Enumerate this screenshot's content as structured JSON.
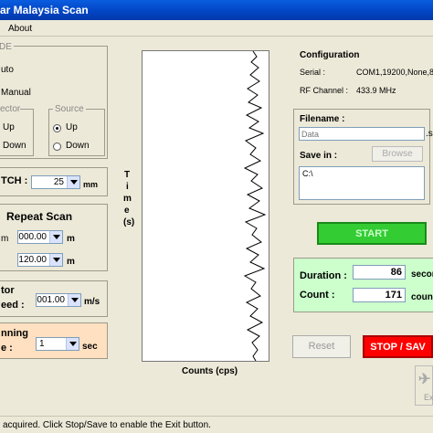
{
  "window": {
    "title": "ar Malaysia Scan"
  },
  "menu": {
    "about": "About"
  },
  "mode": {
    "title": "DE",
    "auto": "uto",
    "manual": "Manual",
    "detector_title": "ector",
    "detector_up": "Up",
    "detector_down": "Down",
    "source_title": "Source",
    "source_up": "Up",
    "source_down": "Down"
  },
  "pitch": {
    "label": "TCH :",
    "value": "25",
    "unit": "mm"
  },
  "repeat_scan": {
    "title": "Repeat Scan",
    "from_label": "m",
    "from_value": "000.00",
    "from_unit": "m",
    "to_value": "120.00",
    "to_unit": "m"
  },
  "detector_speed": {
    "label_line1": "tor",
    "label_line2": "eed :",
    "value": "001.00",
    "unit": "m/s"
  },
  "scanning_time": {
    "label_line1": "nning",
    "label_line2": "e :",
    "value": "1",
    "unit": "sec"
  },
  "plot": {
    "y_label": [
      "T",
      "i",
      "m",
      "e",
      "(s)"
    ],
    "x_label": "Counts (cps)"
  },
  "configuration": {
    "title": "Configuration",
    "serial_label": "Serial :",
    "serial_value": "COM1,19200,None,8,",
    "rf_label": "RF Channel :",
    "rf_value": "433.9 MHz"
  },
  "file": {
    "filename_label": "Filename :",
    "filename_placeholder": "Data",
    "ext": ".s",
    "savein_label": "Save in :",
    "browse_label": "Browse",
    "savein_value": "C:\\"
  },
  "buttons": {
    "start": "START",
    "reset": "Reset",
    "stop_save": "STOP / SAV",
    "exit": "Ex"
  },
  "stats": {
    "duration_label": "Duration :",
    "duration_value": "86",
    "duration_unit": "secon",
    "count_label": "Count :",
    "count_value": "171",
    "count_unit": "count"
  },
  "status": {
    "text": "acquired. Click Stop/Save to enable the Exit button."
  },
  "colors": {
    "start_bg": "#33cc33",
    "stop_bg": "#ff0000",
    "stats_bg": "#ccffcc",
    "time_bg": "#ffe0c0",
    "titlebar": "#0244c3"
  }
}
